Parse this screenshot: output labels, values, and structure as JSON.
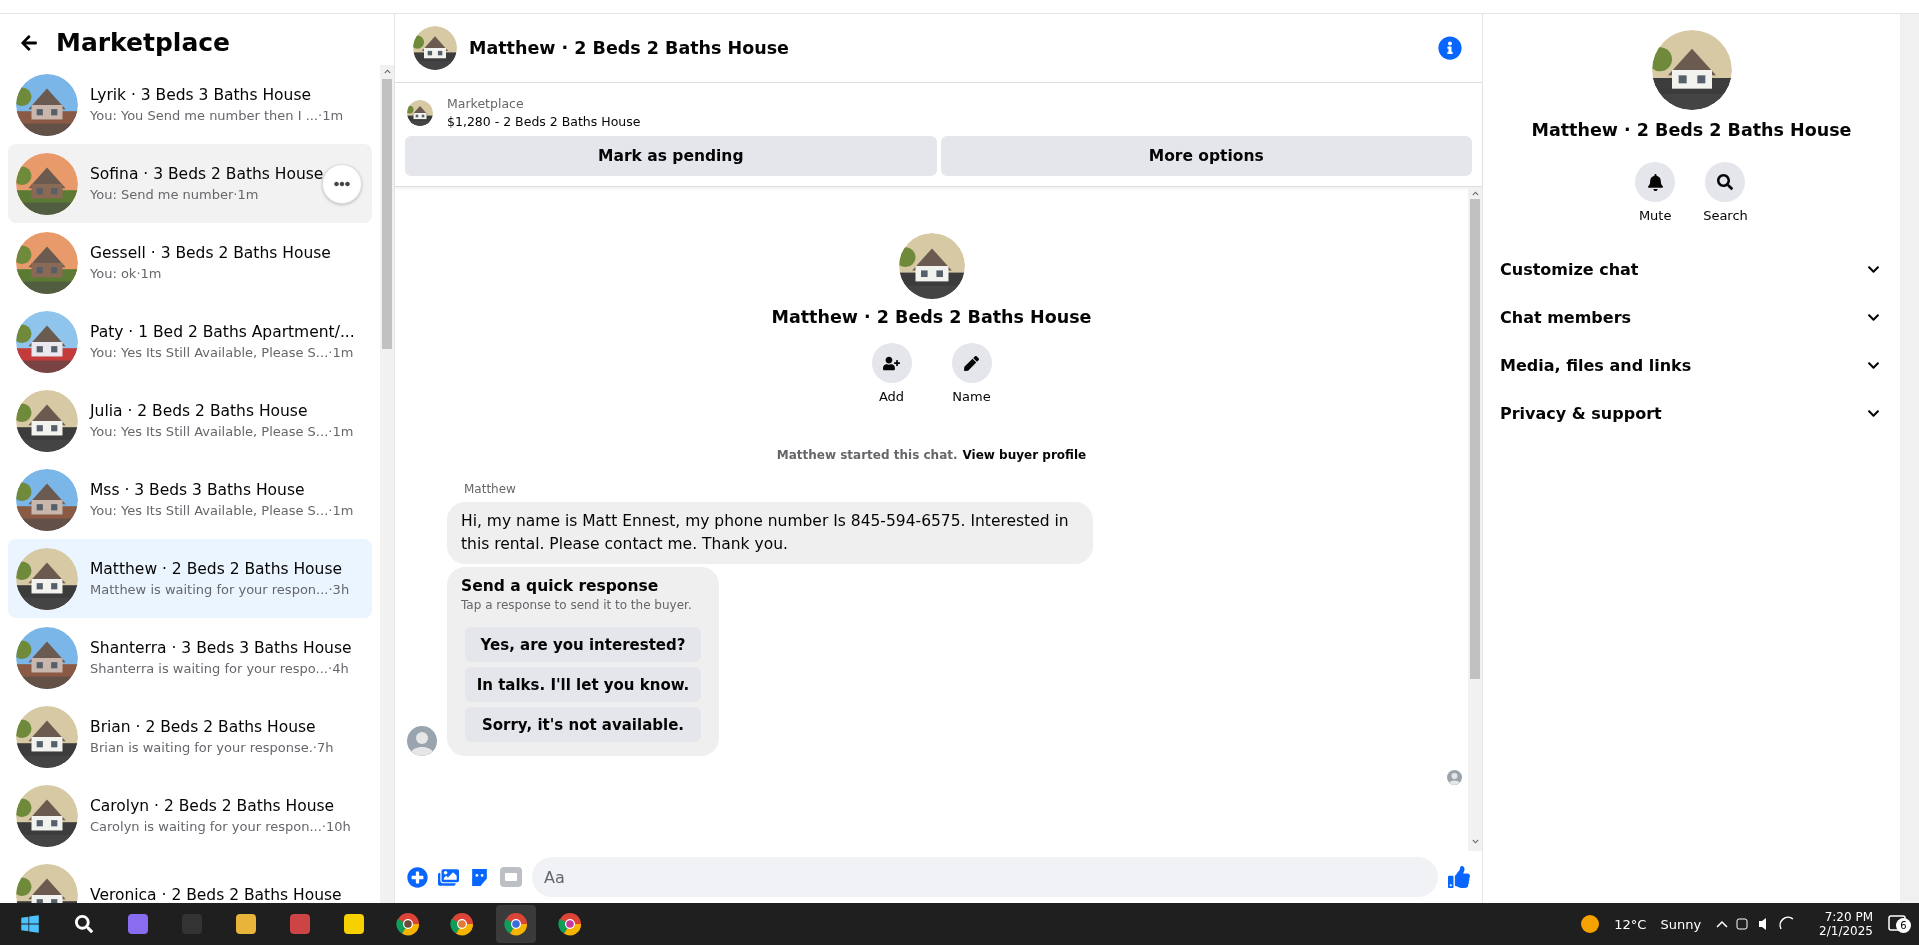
{
  "sidebar": {
    "title": "Marketplace",
    "conversations": [
      {
        "name": "Lyrik · 3 Beds 3 Baths House",
        "preview": "You: You Send me number then I ...",
        "time": "·1m",
        "selected": false,
        "hovered": false
      },
      {
        "name": "Sofina · 3 Beds 2 Baths House",
        "preview": "You: Send me number",
        "time": "·1m",
        "selected": false,
        "hovered": true
      },
      {
        "name": "Gessell · 3 Beds 2 Baths House",
        "preview": "You: ok",
        "time": "·1m",
        "selected": false,
        "hovered": false
      },
      {
        "name": "Paty · 1 Bed 2 Baths Apartment/...",
        "preview": "You: Yes Its Still Available, Please S...",
        "time": "·1m",
        "selected": false,
        "hovered": false
      },
      {
        "name": "Julia · 2 Beds 2 Baths House",
        "preview": "You: Yes Its Still Available, Please S...",
        "time": "·1m",
        "selected": false,
        "hovered": false
      },
      {
        "name": "Mss · 3 Beds 3 Baths House",
        "preview": "You: Yes Its Still Available, Please S...",
        "time": "·1m",
        "selected": false,
        "hovered": false
      },
      {
        "name": "Matthew · 2 Beds 2 Baths House",
        "preview": "Matthew is waiting for your respon...",
        "time": "·3h",
        "selected": true,
        "hovered": false
      },
      {
        "name": "Shanterra · 3 Beds 3 Baths House",
        "preview": "Shanterra is waiting for your respo...",
        "time": "·4h",
        "selected": false,
        "hovered": false
      },
      {
        "name": "Brian · 2 Beds 2 Baths House",
        "preview": "Brian is waiting for your response.",
        "time": "·7h",
        "selected": false,
        "hovered": false
      },
      {
        "name": "Carolyn · 2 Beds 2 Baths House",
        "preview": "Carolyn is waiting for your respon...",
        "time": "·10h",
        "selected": false,
        "hovered": false
      },
      {
        "name": "Veronica · 2 Beds 2 Baths House"
      }
    ]
  },
  "chat": {
    "title": "Matthew · 2 Beds 2 Baths House",
    "listing": {
      "label": "Marketplace",
      "item": "$1,280 - 2 Beds 2 Baths House",
      "buttons": [
        "Mark as pending",
        "More options"
      ]
    },
    "intro": {
      "title": "Matthew · 2 Beds 2 Baths House",
      "actions": [
        "Add",
        "Name"
      ]
    },
    "system": {
      "text": "Matthew started this chat.",
      "link": "View buyer profile"
    },
    "sender": "Matthew",
    "message": "Hi, my name is Matt Ennest, my phone number Is 845-594-6575. Interested in this rental. Please contact me. Thank you.",
    "quick": {
      "title": "Send a quick response",
      "subtitle": "Tap a response to send it to the buyer.",
      "options": [
        "Yes, are you interested?",
        "In talks. I'll let you know.",
        "Sorry, it's not available."
      ]
    },
    "composer": {
      "placeholder": "Aa"
    }
  },
  "info": {
    "title": "Matthew · 2 Beds 2 Baths House",
    "actions": [
      "Mute",
      "Search"
    ],
    "sections": [
      {
        "label": "Customize chat",
        "expanded": false
      },
      {
        "label": "Chat members",
        "expanded": false
      },
      {
        "label": "Media, files and links",
        "expanded": false
      },
      {
        "label": "Privacy & support",
        "expanded": false
      }
    ]
  },
  "taskbar": {
    "temperature": "12°C",
    "weather": "Sunny",
    "time": "7:20 PM",
    "date": "2/1/2025",
    "notifications": "6"
  }
}
